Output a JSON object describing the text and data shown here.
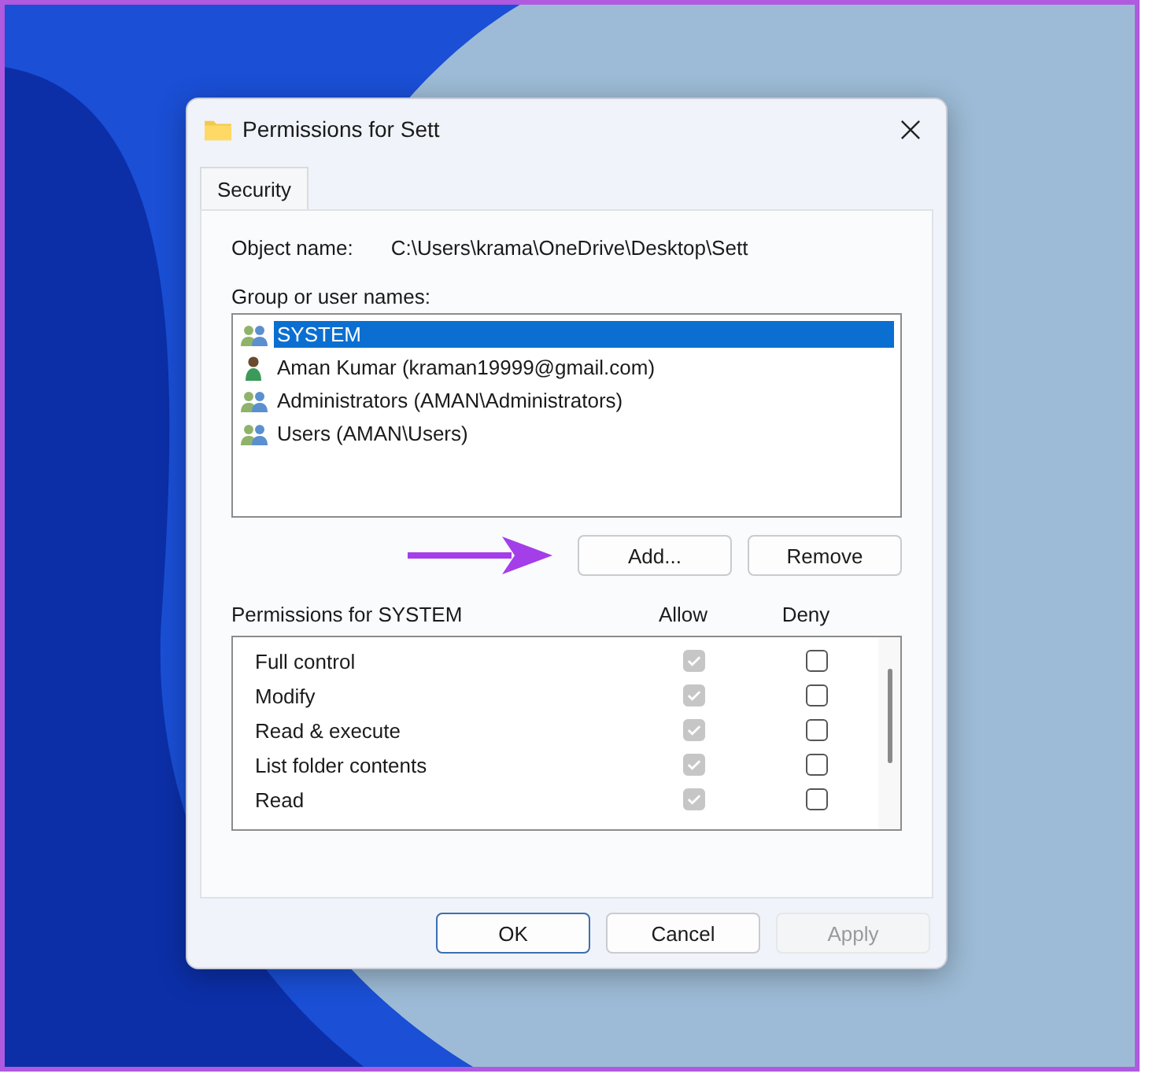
{
  "window": {
    "title": "Permissions for Sett"
  },
  "tabs": [
    {
      "label": "Security",
      "selected": true
    }
  ],
  "object_name": {
    "label": "Object name:",
    "value": "C:\\Users\\krama\\OneDrive\\Desktop\\Sett"
  },
  "group_list": {
    "label": "Group or user names:",
    "items": [
      {
        "name": "SYSTEM",
        "kind": "group",
        "selected": true
      },
      {
        "name": "Aman Kumar (kraman19999@gmail.com)",
        "kind": "user",
        "selected": false
      },
      {
        "name": "Administrators (AMAN\\Administrators)",
        "kind": "group",
        "selected": false
      },
      {
        "name": "Users (AMAN\\Users)",
        "kind": "group",
        "selected": false
      }
    ]
  },
  "list_buttons": [
    {
      "label": "Add...",
      "disabled": false
    },
    {
      "label": "Remove",
      "disabled": false
    }
  ],
  "permissions": {
    "label": "Permissions for SYSTEM",
    "allow_header": "Allow",
    "deny_header": "Deny",
    "rows": [
      {
        "name": "Full control",
        "allow": true,
        "deny": false
      },
      {
        "name": "Modify",
        "allow": true,
        "deny": false
      },
      {
        "name": "Read & execute",
        "allow": true,
        "deny": false
      },
      {
        "name": "List folder contents",
        "allow": true,
        "deny": false
      },
      {
        "name": "Read",
        "allow": true,
        "deny": false
      }
    ]
  },
  "buttons": [
    {
      "label": "OK",
      "default": true,
      "disabled": false
    },
    {
      "label": "Cancel",
      "default": false,
      "disabled": false
    },
    {
      "label": "Apply",
      "default": false,
      "disabled": true
    }
  ]
}
